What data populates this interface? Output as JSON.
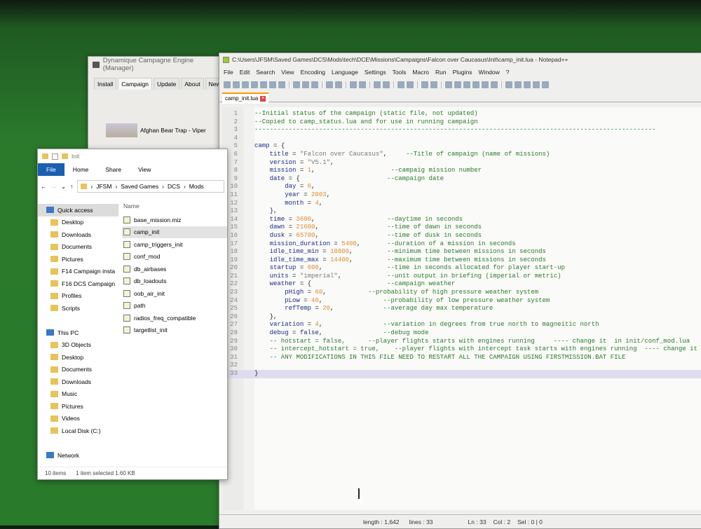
{
  "dce": {
    "title": "Dynamique Campagne Engine (Manager)",
    "tabs": [
      "Install",
      "Campaign",
      "Update",
      "About",
      "News"
    ],
    "campaign": "Afghan Bear Trap - Viper"
  },
  "npp": {
    "title": "C:\\Users\\JFSM\\Saved Games\\DCS\\Mods\\tech\\DCE\\Missions\\Campaigns\\Falcon over Caucasus\\Init\\camp_init.lua - Notepad++",
    "menu": [
      "File",
      "Edit",
      "Search",
      "View",
      "Encoding",
      "Language",
      "Settings",
      "Tools",
      "Macro",
      "Run",
      "Plugins",
      "Window",
      "?"
    ],
    "tab": "camp_init.lua",
    "status": {
      "length": "length : 1,642",
      "lines": "lines : 33",
      "ln": "Ln : 33",
      "col": "Col : 2",
      "sel": "Sel : 0 | 0"
    },
    "code": [
      [
        [
          "cm",
          "--Initial status of the campaign (static file, not updated)"
        ]
      ],
      [
        [
          "cm",
          "--Copied to camp_status.lua and for use in running campaign"
        ]
      ],
      [
        [
          "cm",
          "----------------------------------------------------------------------------------------------------------"
        ]
      ],
      [],
      [
        [
          "kw",
          "camp"
        ],
        [
          "txt",
          " = {"
        ]
      ],
      [
        [
          "txt",
          "    "
        ],
        [
          "kw",
          "title"
        ],
        [
          "txt",
          " = "
        ],
        [
          "str",
          "\"Falcon over Caucasus\""
        ],
        [
          "txt",
          ",     "
        ],
        [
          "cm",
          "--Title of campaign (name of missions)"
        ]
      ],
      [
        [
          "txt",
          "    "
        ],
        [
          "kw",
          "version"
        ],
        [
          "txt",
          " = "
        ],
        [
          "str",
          "\"V5.1\""
        ],
        [
          "txt",
          ","
        ]
      ],
      [
        [
          "txt",
          "    "
        ],
        [
          "kw",
          "mission"
        ],
        [
          "txt",
          " = "
        ],
        [
          "num",
          "1"
        ],
        [
          "txt",
          ",                    "
        ],
        [
          "cm",
          "--campaig mission number"
        ]
      ],
      [
        [
          "txt",
          "    "
        ],
        [
          "kw",
          "date"
        ],
        [
          "txt",
          " = {                       "
        ],
        [
          "cm",
          "--campaign date"
        ]
      ],
      [
        [
          "txt",
          "        "
        ],
        [
          "kw",
          "day"
        ],
        [
          "txt",
          " = "
        ],
        [
          "num",
          "6"
        ],
        [
          "txt",
          ","
        ]
      ],
      [
        [
          "txt",
          "        "
        ],
        [
          "kw",
          "year"
        ],
        [
          "txt",
          " = "
        ],
        [
          "num",
          "2003"
        ],
        [
          "txt",
          ","
        ]
      ],
      [
        [
          "txt",
          "        "
        ],
        [
          "kw",
          "month"
        ],
        [
          "txt",
          " = "
        ],
        [
          "num",
          "4"
        ],
        [
          "txt",
          ","
        ]
      ],
      [
        [
          "txt",
          "    },"
        ]
      ],
      [
        [
          "txt",
          "    "
        ],
        [
          "kw",
          "time"
        ],
        [
          "txt",
          " = "
        ],
        [
          "num",
          "3600"
        ],
        [
          "txt",
          ",                   "
        ],
        [
          "cm",
          "--daytime in seconds"
        ]
      ],
      [
        [
          "txt",
          "    "
        ],
        [
          "kw",
          "dawn"
        ],
        [
          "txt",
          " = "
        ],
        [
          "num",
          "21600"
        ],
        [
          "txt",
          ",                  "
        ],
        [
          "cm",
          "--time of dawn in seconds"
        ]
      ],
      [
        [
          "txt",
          "    "
        ],
        [
          "kw",
          "dusk"
        ],
        [
          "txt",
          " = "
        ],
        [
          "num",
          "65700"
        ],
        [
          "txt",
          ",                  "
        ],
        [
          "cm",
          "--time of dusk in seconds"
        ]
      ],
      [
        [
          "txt",
          "    "
        ],
        [
          "kw",
          "mission_duration"
        ],
        [
          "txt",
          " = "
        ],
        [
          "num",
          "5400"
        ],
        [
          "txt",
          ",       "
        ],
        [
          "cm",
          "--duration of a mission in seconds"
        ]
      ],
      [
        [
          "txt",
          "    "
        ],
        [
          "kw",
          "idle_time_min"
        ],
        [
          "txt",
          " = "
        ],
        [
          "num",
          "10800"
        ],
        [
          "txt",
          ",         "
        ],
        [
          "cm",
          "--minimum time between missions in seconds"
        ]
      ],
      [
        [
          "txt",
          "    "
        ],
        [
          "kw",
          "idle_time_max"
        ],
        [
          "txt",
          " = "
        ],
        [
          "num",
          "14400"
        ],
        [
          "txt",
          ",         "
        ],
        [
          "cm",
          "--maximum time between missions in seconds"
        ]
      ],
      [
        [
          "txt",
          "    "
        ],
        [
          "kw",
          "startup"
        ],
        [
          "txt",
          " = "
        ],
        [
          "num",
          "600"
        ],
        [
          "txt",
          ",                 "
        ],
        [
          "cm",
          "--time in seconds allocated for player start-up"
        ]
      ],
      [
        [
          "txt",
          "    "
        ],
        [
          "kw",
          "units"
        ],
        [
          "txt",
          " = "
        ],
        [
          "str",
          "\"imperial\""
        ],
        [
          "txt",
          ",            "
        ],
        [
          "cm",
          "--unit output in briefing (imperial or metric)"
        ]
      ],
      [
        [
          "txt",
          "    "
        ],
        [
          "kw",
          "weather"
        ],
        [
          "txt",
          " = {                    "
        ],
        [
          "cm",
          "--campaign weather"
        ]
      ],
      [
        [
          "txt",
          "        "
        ],
        [
          "kw",
          "pHigh"
        ],
        [
          "txt",
          " = "
        ],
        [
          "num",
          "60"
        ],
        [
          "txt",
          ",           "
        ],
        [
          "cm",
          "--probability of high pressure weather system"
        ]
      ],
      [
        [
          "txt",
          "        "
        ],
        [
          "kw",
          "pLow"
        ],
        [
          "txt",
          " = "
        ],
        [
          "num",
          "40"
        ],
        [
          "txt",
          ",                "
        ],
        [
          "cm",
          "--probability of low pressure weather system"
        ]
      ],
      [
        [
          "txt",
          "        "
        ],
        [
          "kw",
          "refTemp"
        ],
        [
          "txt",
          " = "
        ],
        [
          "num",
          "20"
        ],
        [
          "txt",
          ",             "
        ],
        [
          "cm",
          "--average day max temperature"
        ]
      ],
      [
        [
          "txt",
          "    },"
        ]
      ],
      [
        [
          "txt",
          "    "
        ],
        [
          "kw",
          "variation"
        ],
        [
          "txt",
          " = "
        ],
        [
          "num",
          "4"
        ],
        [
          "txt",
          ",                "
        ],
        [
          "cm",
          "--variation in degrees from true north to magneitic north"
        ]
      ],
      [
        [
          "txt",
          "    "
        ],
        [
          "kw",
          "debug"
        ],
        [
          "txt",
          " = "
        ],
        [
          "kw",
          "false"
        ],
        [
          "txt",
          ",                "
        ],
        [
          "cm",
          "--debug mode"
        ]
      ],
      [
        [
          "txt",
          "    "
        ],
        [
          "cm",
          "-- hotstart = false,      --player flights starts with engines running     ---- change it  in init/conf_mod.lua"
        ]
      ],
      [
        [
          "txt",
          "    "
        ],
        [
          "cm",
          "-- intercept_hotstart = true,    --player flights with intercept task starts with engines running  ---- change it  in init/"
        ]
      ],
      [
        [
          "txt",
          "    "
        ],
        [
          "cm",
          "-- ANY MODIFICATIONS IN THIS FILE NEED TO RESTART ALL THE CAMPAIGN USING FIRSTMISSION.BAT FILE"
        ]
      ],
      [],
      [
        [
          "txt",
          "}"
        ]
      ]
    ]
  },
  "explorer": {
    "title": "Init",
    "ribbon": [
      "File",
      "Home",
      "Share",
      "View"
    ],
    "path": [
      "JFSM",
      "Saved Games",
      "DCS",
      "Mods"
    ],
    "col_name": "Name",
    "nav": [
      {
        "label": "Quick access",
        "sel": true
      },
      {
        "label": "Desktop",
        "sub": true
      },
      {
        "label": "Downloads",
        "sub": true
      },
      {
        "label": "Documents",
        "sub": true
      },
      {
        "label": "Pictures",
        "sub": true
      },
      {
        "label": "F14 Campaign insta",
        "sub": true
      },
      {
        "label": "F16 DCS Campaign",
        "sub": true
      },
      {
        "label": "Profiles",
        "sub": true
      },
      {
        "label": "Scripts",
        "sub": true
      },
      {
        "label": ""
      },
      {
        "label": "This PC"
      },
      {
        "label": "3D Objects",
        "sub": true
      },
      {
        "label": "Desktop",
        "sub": true
      },
      {
        "label": "Documents",
        "sub": true
      },
      {
        "label": "Downloads",
        "sub": true
      },
      {
        "label": "Music",
        "sub": true
      },
      {
        "label": "Pictures",
        "sub": true
      },
      {
        "label": "Videos",
        "sub": true
      },
      {
        "label": "Local Disk (C:)",
        "sub": true
      },
      {
        "label": ""
      },
      {
        "label": "Network"
      }
    ],
    "files": [
      "base_mission.miz",
      "camp_init",
      "camp_triggers_init",
      "conf_mod",
      "db_airbases",
      "db_loadouts",
      "oob_air_init",
      "path",
      "radios_freq_compatible",
      "targetlist_init"
    ],
    "selected_file": "camp_init",
    "status": {
      "items": "10 items",
      "selected": "1 item selected  1.60 KB"
    }
  }
}
